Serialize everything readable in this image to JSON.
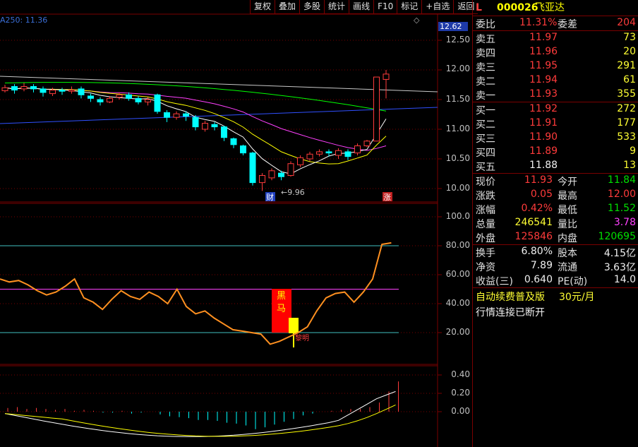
{
  "toolbar": [
    "复权",
    "叠加",
    "多股",
    "统计",
    "画线",
    "F10",
    "标记",
    "+自选",
    "返回"
  ],
  "ma_info": "A250: 11.36",
  "gear_icon": "◇",
  "current_price_tag": "12.62",
  "axis_main": [
    "12.50",
    "12.00",
    "11.50",
    "11.00",
    "10.50",
    "10.00"
  ],
  "axis_ind": [
    "100.0",
    "80.00",
    "60.00",
    "40.00",
    "20.00"
  ],
  "axis_macd": [
    "0.40",
    "0.20",
    "0.00"
  ],
  "annotations": {
    "low_price": "←9.96",
    "cai": "财",
    "zhang": "涨",
    "heima": "黑马",
    "liming": "黎明"
  },
  "colors": {
    "up": "#ff3b3b",
    "down": "#00ffff",
    "ma5": "#ffffff",
    "ma10": "#ffff00",
    "ma20": "#ff40ff",
    "ma60": "#00ff00",
    "ma120": "#3050ff"
  },
  "stock": {
    "flag": "L",
    "code": "000026",
    "name": "飞亚达"
  },
  "weibi": {
    "label": "委比",
    "value": "11.31%",
    "diff_label": "委差",
    "diff_value": "204"
  },
  "sell": [
    {
      "label": "卖五",
      "price": "11.97",
      "vol": "73"
    },
    {
      "label": "卖四",
      "price": "11.96",
      "vol": "20"
    },
    {
      "label": "卖三",
      "price": "11.95",
      "vol": "291"
    },
    {
      "label": "卖二",
      "price": "11.94",
      "vol": "61"
    },
    {
      "label": "卖一",
      "price": "11.93",
      "vol": "355"
    }
  ],
  "buy": [
    {
      "label": "买一",
      "price": "11.92",
      "vol": "272"
    },
    {
      "label": "买二",
      "price": "11.91",
      "vol": "177"
    },
    {
      "label": "买三",
      "price": "11.90",
      "vol": "533"
    },
    {
      "label": "买四",
      "price": "11.89",
      "vol": "9"
    },
    {
      "label": "买五",
      "price": "11.88",
      "vol": "13"
    }
  ],
  "stats1": [
    {
      "l1": "现价",
      "v1": "11.93",
      "l2": "今开",
      "v2": "11.84"
    },
    {
      "l1": "涨跌",
      "v1": "0.05",
      "l2": "最高",
      "v2": "12.00"
    },
    {
      "l1": "涨幅",
      "v1": "0.42%",
      "l2": "最低",
      "v2": "11.52"
    },
    {
      "l1": "总量",
      "v1": "246541",
      "l2": "量比",
      "v2": "3.78"
    },
    {
      "l1": "外盘",
      "v1": "125846",
      "l2": "内盘",
      "v2": "120695"
    }
  ],
  "stats2": [
    {
      "l1": "换手",
      "v1": "6.80%",
      "l2": "股本",
      "v2": "4.15亿"
    },
    {
      "l1": "净资",
      "v1": "7.89",
      "l2": "流通",
      "v2": "3.63亿"
    },
    {
      "l1": "收益(三)",
      "v1": "0.640",
      "l2": "PE(动)",
      "v2": "14.0"
    }
  ],
  "promo": {
    "text": "自动续费普及版",
    "price": "30元/月"
  },
  "status": "行情连接已断开",
  "chart_data": {
    "type": "candlestick",
    "candles": [
      [
        11.65,
        11.7,
        11.62,
        11.75
      ],
      [
        11.72,
        11.66,
        11.6,
        11.76
      ],
      [
        11.68,
        11.72,
        11.64,
        11.78
      ],
      [
        11.72,
        11.68,
        11.62,
        11.76
      ],
      [
        11.68,
        11.62,
        11.55,
        11.72
      ],
      [
        11.6,
        11.66,
        11.56,
        11.7
      ],
      [
        11.66,
        11.64,
        11.58,
        11.7
      ],
      [
        11.64,
        11.66,
        11.6,
        11.72
      ],
      [
        11.68,
        11.58,
        11.52,
        11.72
      ],
      [
        11.56,
        11.52,
        11.46,
        11.6
      ],
      [
        11.5,
        11.46,
        11.4,
        11.54
      ],
      [
        11.46,
        11.52,
        11.44,
        11.56
      ],
      [
        11.54,
        11.58,
        11.5,
        11.62
      ],
      [
        11.58,
        11.52,
        11.48,
        11.62
      ],
      [
        11.52,
        11.46,
        11.42,
        11.56
      ],
      [
        11.46,
        11.5,
        11.4,
        11.54
      ],
      [
        11.58,
        11.3,
        11.26,
        11.6
      ],
      [
        11.28,
        11.2,
        11.12,
        11.32
      ],
      [
        11.2,
        11.26,
        11.16,
        11.3
      ],
      [
        11.26,
        11.22,
        11.14,
        11.3
      ],
      [
        11.2,
        11.04,
        10.98,
        11.24
      ],
      [
        11.0,
        11.1,
        10.96,
        11.14
      ],
      [
        11.08,
        11.04,
        10.98,
        11.12
      ],
      [
        11.04,
        10.86,
        10.8,
        11.06
      ],
      [
        10.84,
        10.74,
        10.68,
        10.86
      ],
      [
        10.72,
        10.6,
        10.56,
        10.74
      ],
      [
        10.6,
        10.1,
        10.05,
        10.62
      ],
      [
        10.1,
        10.22,
        9.96,
        10.26
      ],
      [
        10.18,
        10.3,
        10.14,
        10.34
      ],
      [
        10.26,
        10.2,
        10.14,
        10.3
      ],
      [
        10.22,
        10.42,
        10.2,
        10.46
      ],
      [
        10.4,
        10.52,
        10.36,
        10.56
      ],
      [
        10.5,
        10.58,
        10.46,
        10.62
      ],
      [
        10.58,
        10.62,
        10.54,
        10.66
      ],
      [
        10.62,
        10.6,
        10.54,
        10.66
      ],
      [
        10.56,
        10.64,
        10.5,
        10.68
      ],
      [
        10.62,
        10.54,
        10.48,
        10.66
      ],
      [
        10.6,
        10.72,
        10.56,
        10.76
      ],
      [
        10.72,
        10.8,
        10.7,
        10.82
      ],
      [
        10.8,
        11.88,
        10.8,
        11.88
      ],
      [
        11.84,
        11.93,
        11.52,
        12.0
      ]
    ],
    "ind_line": [
      57,
      55,
      56,
      53,
      49,
      46,
      48,
      52,
      57,
      44,
      41,
      36,
      43,
      49,
      45,
      43,
      48,
      45,
      40,
      50,
      38,
      33,
      35,
      30,
      26,
      22,
      21,
      20,
      19,
      12,
      14,
      17,
      20,
      24,
      35,
      44,
      47,
      48,
      41,
      48,
      57,
      81,
      82
    ],
    "ind_ref_lines": [
      80,
      50,
      20
    ],
    "macd_bars": [
      0.04,
      0.05,
      0.03,
      0.04,
      0.03,
      0.02,
      0.03,
      0.01,
      0.02,
      0.01,
      -0.01,
      -0.01,
      0.01,
      -0.02,
      -0.01,
      0.0,
      -0.03,
      -0.05,
      -0.06,
      -0.07,
      -0.09,
      -0.09,
      -0.1,
      -0.12,
      -0.13,
      -0.15,
      -0.19,
      -0.17,
      -0.14,
      -0.11,
      -0.08,
      -0.04,
      -0.02,
      0.0,
      0.01,
      0.02,
      0.03,
      0.03,
      0.05,
      0.1,
      0.22,
      0.33
    ]
  }
}
